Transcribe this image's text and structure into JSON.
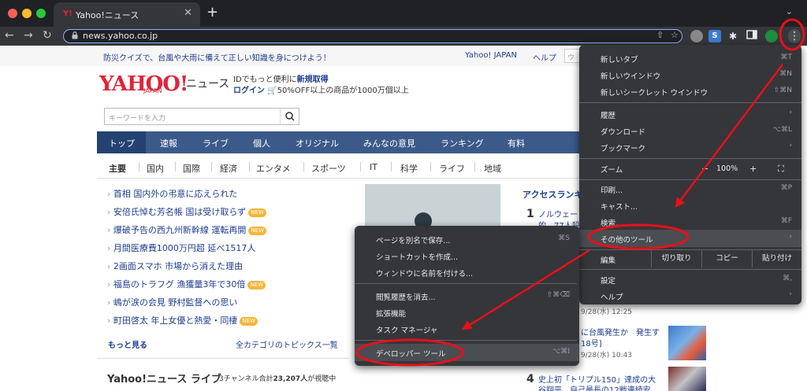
{
  "browser": {
    "tab_title": "Yahoo!ニュース",
    "tab_favicon": "Y!",
    "new_tab": "+",
    "tab_close": "✕",
    "tab_list": "⌄",
    "url": "news.yahoo.co.jp",
    "nav": {
      "back": "←",
      "forward": "→",
      "reload": "↻"
    },
    "colors": {
      "tabbar": "#202124",
      "toolbar": "#35363a",
      "accent": "#8ab4f8"
    }
  },
  "page": {
    "notice": "防災クイズで、台風や大雨に備えて正しい知識を身につけよう！",
    "top_links": [
      "Yahoo! JAPAN",
      "ヘルプ"
    ],
    "top_search_placeholder": "ウェ",
    "logo": "YAHOO!",
    "logo_sub": "JAPAN",
    "logo_news": "ニュース",
    "id_prefix": "IDでもっと便利に",
    "id_register": "新規取得",
    "login": "ログイン",
    "promo": "🛒50%OFF以上の商品が1000万個以上",
    "search_placeholder": "キーワードを入力",
    "nav": [
      "トップ",
      "速報",
      "ライブ",
      "個人",
      "オリジナル",
      "みんなの意見",
      "ランキング",
      "有料"
    ],
    "subnav": [
      "主要",
      "国内",
      "国際",
      "経済",
      "エンタメ",
      "スポーツ",
      "IT",
      "科学",
      "ライフ",
      "地域"
    ],
    "headlines": [
      {
        "text": "首相 国内外の弔意に応えられた",
        "new": false
      },
      {
        "text": "安倍氏悼む芳名帳 国は受け取らず",
        "new": true
      },
      {
        "text": "爆破予告の西九州新幹線 運転再開",
        "new": true
      },
      {
        "text": "月間医療費1000万円超 延べ1517人",
        "new": false
      },
      {
        "text": "2画面スマホ 市場から消えた理由",
        "new": false
      },
      {
        "text": "福島のトラフグ 漁獲量3年で30倍",
        "new": true
      },
      {
        "text": "嶋が涙の会見 野村監督への思い",
        "new": false
      },
      {
        "text": "町田啓太 年上女優と熱愛・同棲",
        "new": true
      }
    ],
    "new_badge": "NEW",
    "more": "もっと見る",
    "all_topics": "全カテゴリのトピックス一覧",
    "live_title": "Yahoo!ニュース ライブ",
    "live_sub_prefix": "3チャンネル合計",
    "live_viewers": "23,207人",
    "live_sub_suffix": "が視聴中",
    "access_ranking": "アクセスランキ",
    "ranking": [
      {
        "num": "1",
        "line1": "ノルウェー",
        "line2": "的　77人殺"
      },
      {
        "num": "3",
        "line1": "",
        "line2": "に台風発生か　発生す",
        "line3": "18号]",
        "date": "9/28(水) 10:43"
      },
      {
        "num": "4",
        "line1": "史上初「トリプル150」達成の大",
        "line2": "谷翔平　自己最長の12戦連続安"
      }
    ],
    "partial_date": "9/28(水) 12:25"
  },
  "menu": {
    "items": [
      {
        "label": "新しいタブ",
        "shortcut": "⌘T"
      },
      {
        "label": "新しいウインドウ",
        "shortcut": "⌘N"
      },
      {
        "label": "新しいシークレット ウインドウ",
        "shortcut": "⇧⌘N"
      },
      {
        "label": "履歴",
        "arrow": "›"
      },
      {
        "label": "ダウンロード",
        "shortcut": "⌥⌘L"
      },
      {
        "label": "ブックマーク",
        "arrow": "›"
      },
      {
        "label": "印刷...",
        "shortcut": "⌘P"
      },
      {
        "label": "キャスト...",
        "shortcut": ""
      },
      {
        "label": "検索...",
        "shortcut": "⌘F"
      },
      {
        "label": "その他のツール",
        "arrow": "›"
      },
      {
        "label": "設定",
        "shortcut": "⌘,"
      },
      {
        "label": "ヘルプ",
        "arrow": "›"
      }
    ],
    "zoom": {
      "label": "ズーム",
      "minus": "−",
      "value": "100%",
      "plus": "+",
      "fullscreen": "⛶"
    },
    "edit": {
      "label": "編集",
      "cut": "切り取り",
      "copy": "コピー",
      "paste": "貼り付け"
    }
  },
  "submenu": {
    "items": [
      {
        "label": "ページを別名で保存...",
        "shortcut": "⌘S"
      },
      {
        "label": "ショートカットを作成...",
        "shortcut": ""
      },
      {
        "label": "ウィンドウに名前を付ける...",
        "shortcut": ""
      },
      {
        "label": "閲覧履歴を消去...",
        "shortcut": "⇧⌘⌫"
      },
      {
        "label": "拡張機能",
        "shortcut": ""
      },
      {
        "label": "タスク マネージャ",
        "shortcut": ""
      },
      {
        "label": "デベロッパー ツール",
        "shortcut": "⌥⌘I"
      }
    ]
  },
  "annotation_color": "#e8101a"
}
